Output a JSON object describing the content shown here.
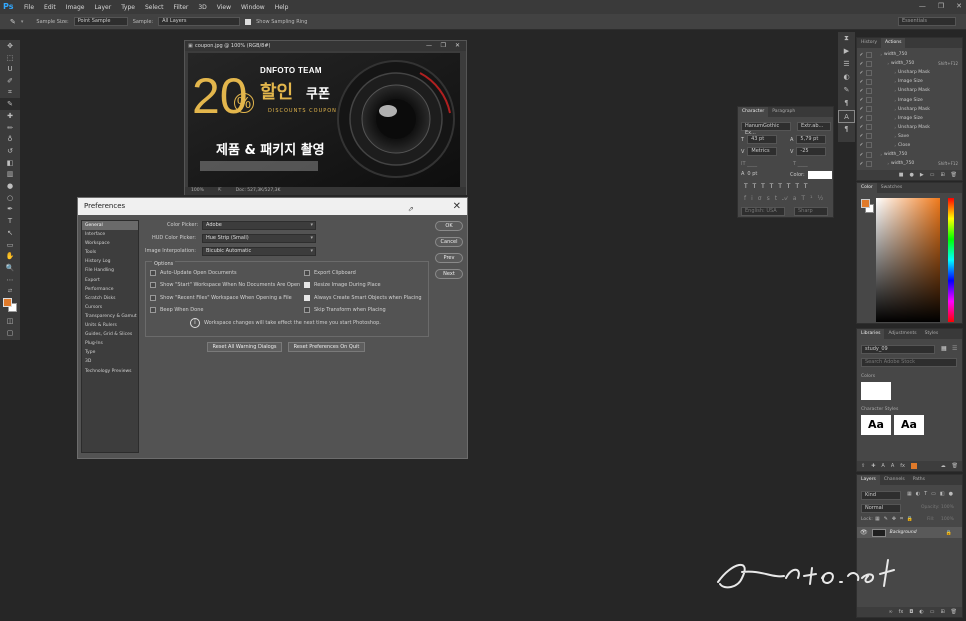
{
  "menubar": {
    "logo": "Ps",
    "items": [
      "File",
      "Edit",
      "Image",
      "Layer",
      "Type",
      "Select",
      "Filter",
      "3D",
      "View",
      "Window",
      "Help"
    ],
    "win_controls": [
      "—",
      "❐",
      "✕"
    ]
  },
  "options_bar": {
    "sample_size_label": "Sample Size:",
    "sample_size_value": "Point Sample",
    "sample_label": "Sample:",
    "sample_value": "All Layers",
    "sampling_ring_label": "Show Sampling Ring",
    "workspace": "Essentials"
  },
  "document": {
    "title": "coupon.jpg @ 100% (RGB/8#)",
    "zoom": "100%",
    "doc_size": "Doc: 527,3K/527,3K",
    "banner": {
      "brand": "DNFOTO TEAM",
      "big_number": "20",
      "percent": "%",
      "korean_main": "할인",
      "korean_sub": "쿠폰",
      "subtitle": "DISCOUNTS COUPON",
      "tagline": "제품 & 패키지 촬영",
      "colors": {
        "gold": "#e3b64c",
        "white": "#ffffff",
        "dark": "#1a1a1a"
      }
    }
  },
  "preferences": {
    "title": "Preferences",
    "categories": [
      "General",
      "Interface",
      "Workspace",
      "Tools",
      "History Log",
      "File Handling",
      "Export",
      "Performance",
      "Scratch Disks",
      "Cursors",
      "Transparency & Gamut",
      "Units & Rulers",
      "Guides, Grid & Slices",
      "Plug-Ins",
      "Type",
      "3D",
      "Technology Previews"
    ],
    "selected_category": "General",
    "color_picker_label": "Color Picker:",
    "color_picker_value": "Adobe",
    "hud_label": "HUD Color Picker:",
    "hud_value": "Hue Strip (Small)",
    "interp_label": "Image Interpolation:",
    "interp_value": "Bicubic Automatic",
    "options_title": "Options",
    "left_options": [
      {
        "label": "Auto-Update Open Documents",
        "checked": false
      },
      {
        "label": "Show \"Start\" Workspace When No Documents Are Open",
        "checked": false
      },
      {
        "label": "Show \"Recent Files\" Workspace When Opening a File",
        "checked": false
      },
      {
        "label": "Beep When Done",
        "checked": false
      }
    ],
    "right_options": [
      {
        "label": "Export Clipboard",
        "checked": false
      },
      {
        "label": "Resize Image During Place",
        "checked": true
      },
      {
        "label": "Always Create Smart Objects when Placing",
        "checked": true
      },
      {
        "label": "Skip Transform when Placing",
        "checked": false
      }
    ],
    "info_text": "Workspace changes will take effect the next time you start Photoshop.",
    "buttons": {
      "ok": "OK",
      "cancel": "Cancel",
      "prev": "Prev",
      "next": "Next"
    },
    "reset_warnings": "Reset All Warning Dialogs",
    "reset_prefs": "Reset Preferences On Quit"
  },
  "actions_panel": {
    "tabs": [
      "History",
      "Actions"
    ],
    "active_tab": "Actions",
    "rows": [
      {
        "label": "width_750",
        "indent": 1,
        "shortcut": ""
      },
      {
        "label": "width_750",
        "indent": 2,
        "shortcut": "Shift+F12"
      },
      {
        "label": "Unsharp Mask",
        "indent": 3,
        "shortcut": ""
      },
      {
        "label": "Image Size",
        "indent": 3,
        "shortcut": ""
      },
      {
        "label": "Unsharp Mask",
        "indent": 3,
        "shortcut": ""
      },
      {
        "label": "Image Size",
        "indent": 3,
        "shortcut": ""
      },
      {
        "label": "Unsharp Mask",
        "indent": 3,
        "shortcut": ""
      },
      {
        "label": "Image Size",
        "indent": 3,
        "shortcut": ""
      },
      {
        "label": "Unsharp Mask",
        "indent": 3,
        "shortcut": ""
      },
      {
        "label": "Save",
        "indent": 3,
        "shortcut": ""
      },
      {
        "label": "Close",
        "indent": 3,
        "shortcut": ""
      },
      {
        "label": "width_750",
        "indent": 1,
        "shortcut": ""
      },
      {
        "label": "width_750",
        "indent": 2,
        "shortcut": "Shift+F12"
      }
    ]
  },
  "character_panel": {
    "tabs": [
      "Character",
      "Paragraph"
    ],
    "font_family": "HanumGothic Ex...",
    "font_style": "Extr.ab...",
    "size": "43 pt",
    "leading": "5,79 pt",
    "kerning": "Metrics",
    "tracking": "-25",
    "baseline": "0 pt",
    "color_label": "Color:",
    "language": "English: USA",
    "aa": "Sharp"
  },
  "color_panel": {
    "tabs": [
      "Color",
      "Swatches"
    ],
    "fg": "#e07a2a",
    "bg": "#ffffff",
    "hue": "#f07a1c"
  },
  "libraries_panel": {
    "tabs": [
      "Libraries",
      "Adjustments",
      "Styles"
    ],
    "library_name": "study_09",
    "search_placeholder": "Search Adobe Stock",
    "colors_label": "Colors",
    "char_styles_label": "Character Styles",
    "style_sample": "Aa"
  },
  "layers_panel": {
    "tabs": [
      "Layers",
      "Channels",
      "Paths"
    ],
    "kind": "Kind",
    "blend": "Normal",
    "opacity_label": "Opacity:",
    "opacity": "100%",
    "lock_label": "Lock:",
    "fill_label": "Fill:",
    "fill": "100%",
    "layer_name": "Background"
  },
  "signature": {
    "text": "Dnfoto.net"
  }
}
